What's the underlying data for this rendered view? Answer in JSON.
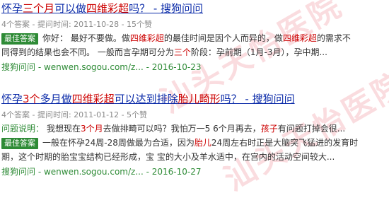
{
  "results": [
    {
      "title_parts": [
        "怀孕",
        "三个月",
        "可以做",
        "四维彩超",
        "吗？ - 搜狗问问"
      ],
      "meta": "4个答案 - 提问时间: 2011-10-28 - 15个赞",
      "badge": "最佳答案",
      "answer_parts": [
        "你好： 最好不要做。做",
        "四维彩超",
        "的最佳时间是因个人而异的，做",
        "四维彩超",
        "的需求不"
      ],
      "answer_line2_parts": [
        "同得到的结果也会不同。 一般而言孕期可分为",
        "三个",
        "阶段：孕前期（1月-3月），孕中期..."
      ],
      "source": "搜狗问问 - wenwen.sogou.com/z... - 2016-10-23"
    },
    {
      "title_parts": [
        "怀孕",
        "3个",
        "多月做",
        "四维彩超",
        "可以达到排除",
        "胎儿畸形",
        "吗？ - 搜狗问问"
      ],
      "meta": "4个答案 - 提问时间: 2011-01-12 - 5个赞",
      "question_label": "问题说明：",
      "question_parts": [
        "我想现在",
        "3个月",
        "去做排畸可以吗？我怕万一5 6个月再去，",
        "孩子",
        "有问题打掉会很..."
      ],
      "badge": "最佳答案",
      "answer_parts": [
        "一般在怀孕24周-28周做最为合适，因为",
        "胎儿",
        "24周左右时正是大脑突飞猛进的发育时"
      ],
      "answer_line2": "期，这个时期的胎宝宝结构已经形成，宝 宝的大小及羊水适中，在宫内的活动空间较大...",
      "source": "搜狗问问 - wenwen.sogou.com/z... - 2016-10-27"
    }
  ],
  "watermark": "汕头天怡医院"
}
